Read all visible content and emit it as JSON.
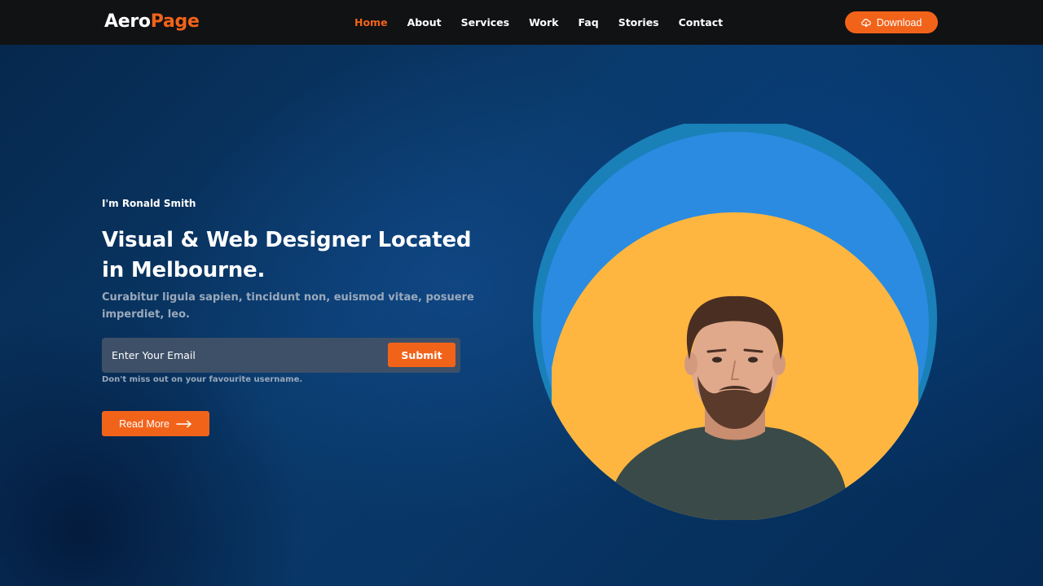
{
  "brand": {
    "part1": "Aero",
    "part2": "Page"
  },
  "nav": {
    "items": [
      {
        "label": "Home",
        "active": true
      },
      {
        "label": "About",
        "active": false
      },
      {
        "label": "Services",
        "active": false
      },
      {
        "label": "Work",
        "active": false
      },
      {
        "label": "Faq",
        "active": false
      },
      {
        "label": "Stories",
        "active": false
      },
      {
        "label": "Contact",
        "active": false
      }
    ],
    "download_label": "Download",
    "download_icon": "cloud-download-icon"
  },
  "hero": {
    "intro": "I'm Ronald Smith",
    "headline": "Visual & Web Designer Located in Melbourne.",
    "subtext": "Curabitur ligula sapien, tincidunt non, euismod vitae, posuere imperdiet, leo.",
    "email_placeholder": "Enter Your Email",
    "submit_label": "Submit",
    "hint": "Don't miss out on your favourite username.",
    "readmore_label": "Read More",
    "readmore_icon": "arrow-right-icon"
  },
  "colors": {
    "accent": "#f2631a",
    "nav_bg": "#111214",
    "hero_bg": "#0a3a6b",
    "ring_outer": "#1a80b8",
    "ring_middle": "#2a8be0",
    "circle_inner": "#ffb640"
  }
}
